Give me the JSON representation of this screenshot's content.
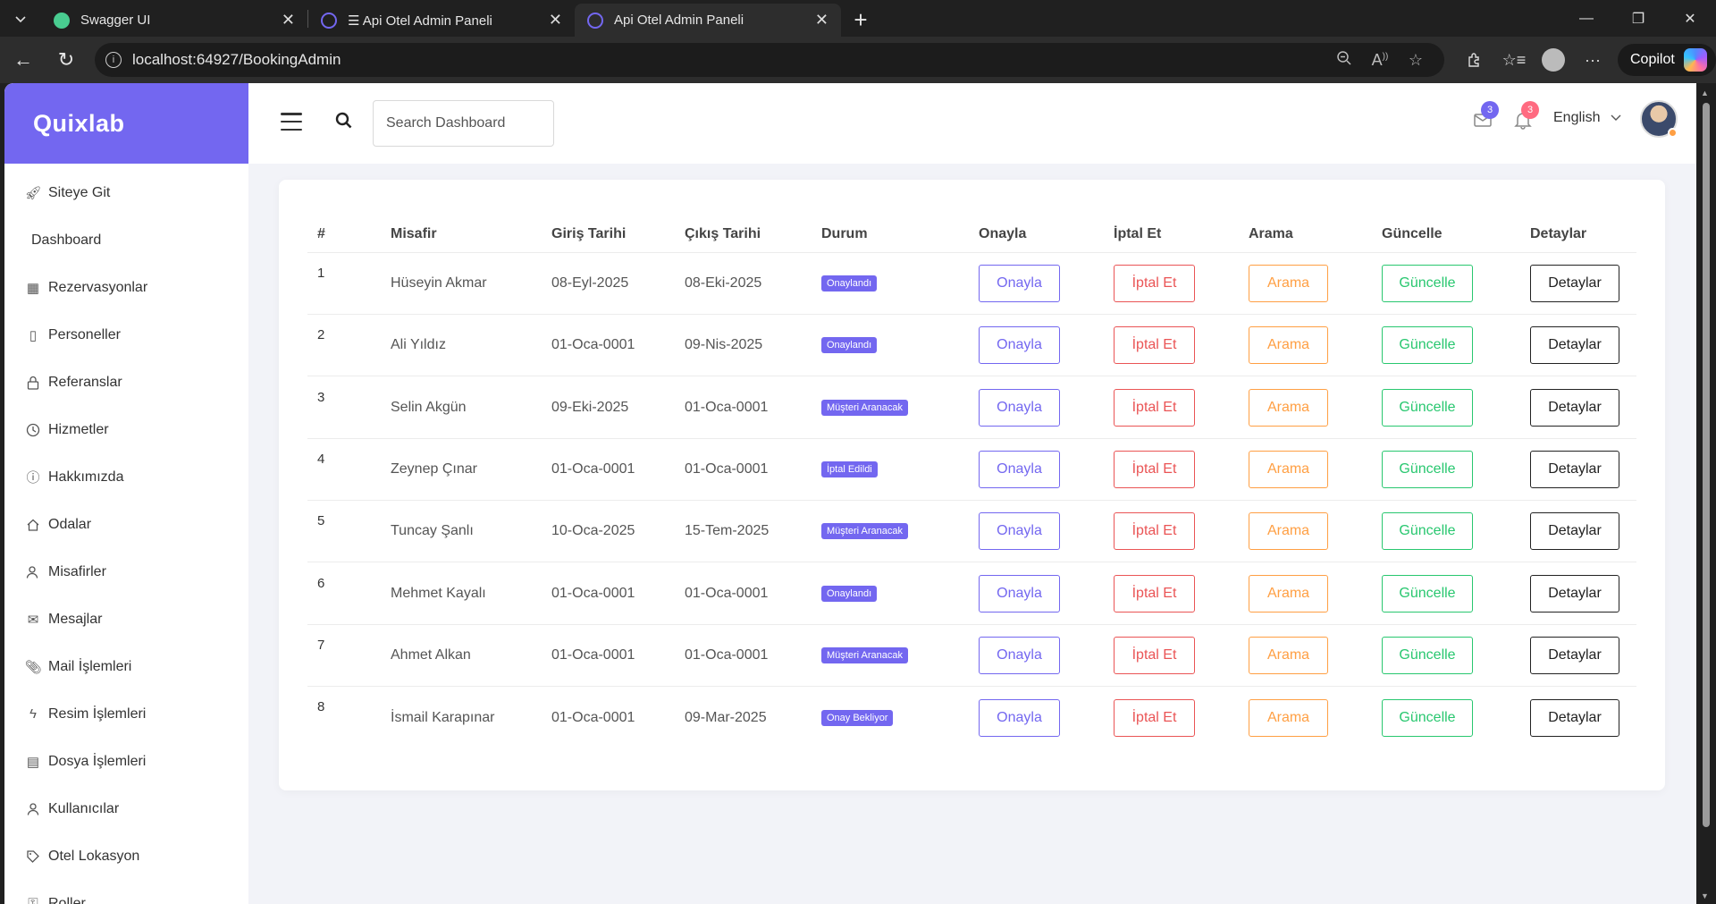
{
  "browser": {
    "tabs": [
      {
        "title": "Swagger UI",
        "favicon_color": "#49cc90",
        "active": false
      },
      {
        "title": "☰ Api Otel Admin Paneli",
        "favicon_color": "#7367f0",
        "active": false
      },
      {
        "title": "Api Otel Admin Paneli",
        "favicon_color": "#7367f0",
        "active": true
      }
    ],
    "url": "localhost:64927/BookingAdmin",
    "copilot_label": "Copilot"
  },
  "brand": "Quixlab",
  "sidebar": {
    "items": [
      {
        "label": "Siteye Git",
        "icon": "rocket-icon"
      },
      {
        "label": "Dashboard",
        "icon": ""
      },
      {
        "label": "Rezervasyonlar",
        "icon": "calendar-icon"
      },
      {
        "label": "Personeller",
        "icon": "badge-icon"
      },
      {
        "label": "Referanslar",
        "icon": "lock-icon"
      },
      {
        "label": "Hizmetler",
        "icon": "clock-icon"
      },
      {
        "label": "Hakkımızda",
        "icon": "info-icon"
      },
      {
        "label": "Odalar",
        "icon": "home-icon"
      },
      {
        "label": "Misafirler",
        "icon": "users-icon"
      },
      {
        "label": "Mesajlar",
        "icon": "mail-icon"
      },
      {
        "label": "Mail İşlemleri",
        "icon": "paperclip-icon"
      },
      {
        "label": "Resim İşlemleri",
        "icon": "bolt-icon"
      },
      {
        "label": "Dosya İşlemleri",
        "icon": "film-icon"
      },
      {
        "label": "Kullanıcılar",
        "icon": "user-icon"
      },
      {
        "label": "Otel Lokasyon",
        "icon": "tag-icon"
      },
      {
        "label": "Roller",
        "icon": "key-icon"
      }
    ]
  },
  "topbar": {
    "search_placeholder": "Search Dashboard",
    "mail_count": "3",
    "notification_count": "3",
    "language": "English",
    "colors": {
      "mail_badge": "#7367f0",
      "notification_badge": "#ea5455"
    }
  },
  "table": {
    "headers": {
      "num": "#",
      "guest": "Misafir",
      "checkin": "Giriş Tarihi",
      "checkout": "Çıkış Tarihi",
      "status": "Durum",
      "approve": "Onayla",
      "cancel": "İptal Et",
      "call": "Arama",
      "update": "Güncelle",
      "details": "Detaylar"
    },
    "buttons": {
      "approve": "Onayla",
      "cancel": "İptal Et",
      "call": "Arama",
      "update": "Güncelle",
      "details": "Detaylar"
    },
    "rows": [
      {
        "num": "1",
        "guest": "Hüseyin Akmar",
        "checkin": "08-Eyl-2025",
        "checkout": "08-Eki-2025",
        "status": "Onaylandı"
      },
      {
        "num": "2",
        "guest": "Ali Yıldız",
        "checkin": "01-Oca-0001",
        "checkout": "09-Nis-2025",
        "status": "Onaylandı"
      },
      {
        "num": "3",
        "guest": "Selin Akgün",
        "checkin": "09-Eki-2025",
        "checkout": "01-Oca-0001",
        "status": "Müşteri Aranacak"
      },
      {
        "num": "4",
        "guest": "Zeynep Çınar",
        "checkin": "01-Oca-0001",
        "checkout": "01-Oca-0001",
        "status": "İptal Edildi"
      },
      {
        "num": "5",
        "guest": "Tuncay Şanlı",
        "checkin": "10-Oca-2025",
        "checkout": "15-Tem-2025",
        "status": "Müşteri Aranacak"
      },
      {
        "num": "6",
        "guest": "Mehmet Kayalı",
        "checkin": "01-Oca-0001",
        "checkout": "01-Oca-0001",
        "status": "Onaylandı"
      },
      {
        "num": "7",
        "guest": "Ahmet Alkan",
        "checkin": "01-Oca-0001",
        "checkout": "01-Oca-0001",
        "status": "Müşteri Aranacak"
      },
      {
        "num": "8",
        "guest": "İsmail Karapınar",
        "checkin": "01-Oca-0001",
        "checkout": "09-Mar-2025",
        "status": "Onay Bekliyor"
      }
    ]
  },
  "colors": {
    "accent": "#7367f0",
    "danger": "#ea5455",
    "warning": "#ff9f43",
    "success": "#28c76f"
  }
}
